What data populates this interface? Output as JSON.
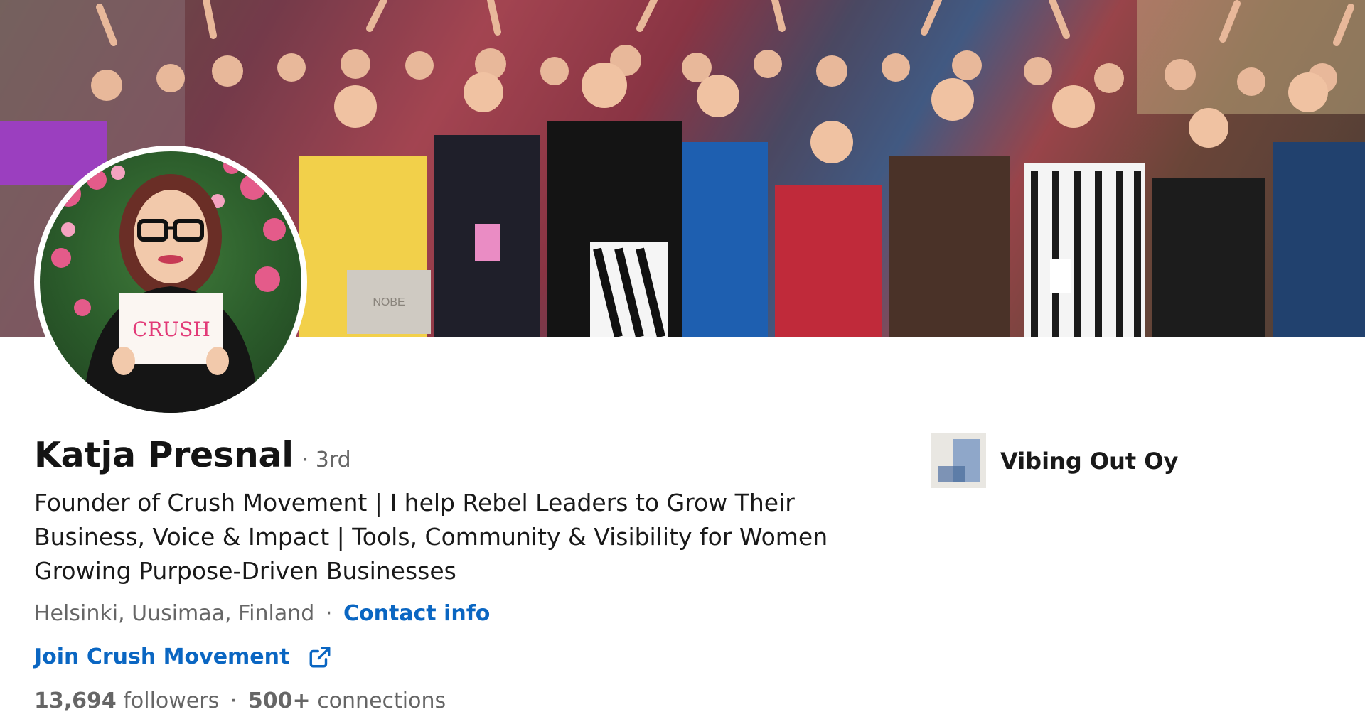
{
  "profile": {
    "name": "Katja Presnal",
    "degree": "· 3rd",
    "headline": "Founder of Crush Movement | I help Rebel Leaders to Grow Their Business, Voice & Impact | Tools, Community & Visibility for Women Growing Purpose-Driven Businesses",
    "location": "Helsinki, Uusimaa, Finland",
    "separator": "·",
    "contact_label": "Contact info",
    "website_label": "Join Crush Movement",
    "followers_count": "13,694",
    "followers_label": "followers",
    "connections_count": "500+",
    "connections_label": "connections",
    "stats_separator": "·"
  },
  "avatar": {
    "sign_text": "CRUSH"
  },
  "banner": {
    "bag_text": "NOBE"
  },
  "company": {
    "name": "Vibing Out Oy",
    "logo_icon": "company-logo-icon"
  },
  "colors": {
    "link": "#0a66c2",
    "text_secondary": "#666666",
    "crush_pink": "#e23a78"
  }
}
